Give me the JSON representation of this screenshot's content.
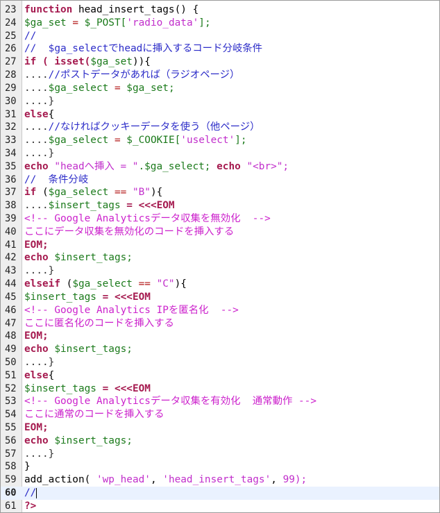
{
  "editor": {
    "current_line": 60,
    "lines": [
      {
        "n": "23",
        "segs": [
          {
            "t": "function",
            "c": "kw"
          },
          {
            "t": " head_insert_tags() {",
            "c": "fn"
          }
        ]
      },
      {
        "n": "24",
        "segs": [
          {
            "t": "$ga_set",
            "c": "var"
          },
          {
            "t": " = ",
            "c": "op"
          },
          {
            "t": "$_POST[",
            "c": "var"
          },
          {
            "t": "'radio_data'",
            "c": "str"
          },
          {
            "t": "];",
            "c": "var"
          }
        ]
      },
      {
        "n": "25",
        "segs": [
          {
            "t": "//",
            "c": "cm"
          }
        ]
      },
      {
        "n": "26",
        "segs": [
          {
            "t": "//  $ga_selectでheadに挿入するコード分岐条件",
            "c": "cm"
          }
        ]
      },
      {
        "n": "27",
        "segs": [
          {
            "t": "if ( isset(",
            "c": "kw"
          },
          {
            "t": "$ga_set",
            "c": "var"
          },
          {
            "t": ")){",
            "c": "fn"
          }
        ]
      },
      {
        "n": "28",
        "segs": [
          {
            "t": "....",
            "c": "ws"
          },
          {
            "t": "//ポストデータがあれば（ラジオページ）",
            "c": "cm"
          }
        ]
      },
      {
        "n": "29",
        "segs": [
          {
            "t": "....",
            "c": "ws"
          },
          {
            "t": "$ga_select",
            "c": "var"
          },
          {
            "t": " = ",
            "c": "op"
          },
          {
            "t": "$ga_set;",
            "c": "var"
          }
        ]
      },
      {
        "n": "30",
        "segs": [
          {
            "t": "....}",
            "c": "ws"
          }
        ]
      },
      {
        "n": "31",
        "segs": [
          {
            "t": "else",
            "c": "kw"
          },
          {
            "t": "{",
            "c": "fn"
          }
        ]
      },
      {
        "n": "32",
        "segs": [
          {
            "t": "....",
            "c": "ws"
          },
          {
            "t": "//なければクッキーデータを使う（他ページ）",
            "c": "cm"
          }
        ]
      },
      {
        "n": "33",
        "segs": [
          {
            "t": "....",
            "c": "ws"
          },
          {
            "t": "$ga_select",
            "c": "var"
          },
          {
            "t": " = ",
            "c": "op"
          },
          {
            "t": "$_COOKIE[",
            "c": "var"
          },
          {
            "t": "'uselect'",
            "c": "str"
          },
          {
            "t": "];",
            "c": "var"
          }
        ]
      },
      {
        "n": "34",
        "segs": [
          {
            "t": "....}",
            "c": "ws"
          }
        ]
      },
      {
        "n": "35",
        "segs": [
          {
            "t": "echo",
            "c": "kw"
          },
          {
            "t": " ",
            "c": "fn"
          },
          {
            "t": "\"headへ挿入 = \"",
            "c": "str"
          },
          {
            "t": ".$ga_select; ",
            "c": "var"
          },
          {
            "t": "echo",
            "c": "kw"
          },
          {
            "t": " ",
            "c": "fn"
          },
          {
            "t": "\"<br>\";",
            "c": "str"
          }
        ]
      },
      {
        "n": "36",
        "segs": [
          {
            "t": "//  条件分岐",
            "c": "cm"
          }
        ]
      },
      {
        "n": "37",
        "segs": [
          {
            "t": "if",
            "c": "kw"
          },
          {
            "t": " (",
            "c": "fn"
          },
          {
            "t": "$ga_select",
            "c": "var"
          },
          {
            "t": " == ",
            "c": "op"
          },
          {
            "t": "\"B\"",
            "c": "str"
          },
          {
            "t": "){",
            "c": "fn"
          }
        ]
      },
      {
        "n": "38",
        "segs": [
          {
            "t": "....",
            "c": "ws"
          },
          {
            "t": "$insert_tags",
            "c": "var"
          },
          {
            "t": " = <<<EOM",
            "c": "kw"
          }
        ]
      },
      {
        "n": "39",
        "segs": [
          {
            "t": "<!-- Google Analyticsデータ収集を無効化  -->",
            "c": "html"
          }
        ]
      },
      {
        "n": "40",
        "segs": [
          {
            "t": "ここにデータ収集を無効化のコードを挿入する",
            "c": "html"
          }
        ]
      },
      {
        "n": "41",
        "segs": [
          {
            "t": "EOM;",
            "c": "kw"
          }
        ]
      },
      {
        "n": "42",
        "segs": [
          {
            "t": "echo",
            "c": "kw"
          },
          {
            "t": " ",
            "c": "fn"
          },
          {
            "t": "$insert_tags;",
            "c": "var"
          }
        ]
      },
      {
        "n": "43",
        "segs": [
          {
            "t": "....}",
            "c": "ws"
          }
        ]
      },
      {
        "n": "44",
        "segs": [
          {
            "t": "elseif",
            "c": "kw"
          },
          {
            "t": " (",
            "c": "fn"
          },
          {
            "t": "$ga_select",
            "c": "var"
          },
          {
            "t": " == ",
            "c": "op"
          },
          {
            "t": "\"C\"",
            "c": "str"
          },
          {
            "t": "){",
            "c": "fn"
          }
        ]
      },
      {
        "n": "45",
        "segs": [
          {
            "t": "$insert_tags",
            "c": "var"
          },
          {
            "t": " = <<<EOM",
            "c": "kw"
          }
        ]
      },
      {
        "n": "46",
        "segs": [
          {
            "t": "<!-- Google Analytics IPを匿名化  -->",
            "c": "html"
          }
        ]
      },
      {
        "n": "47",
        "segs": [
          {
            "t": "ここに匿名化のコードを挿入する",
            "c": "html"
          }
        ]
      },
      {
        "n": "48",
        "segs": [
          {
            "t": "EOM;",
            "c": "kw"
          }
        ]
      },
      {
        "n": "49",
        "segs": [
          {
            "t": "echo",
            "c": "kw"
          },
          {
            "t": " ",
            "c": "fn"
          },
          {
            "t": "$insert_tags;",
            "c": "var"
          }
        ]
      },
      {
        "n": "50",
        "segs": [
          {
            "t": "....}",
            "c": "ws"
          }
        ]
      },
      {
        "n": "51",
        "segs": [
          {
            "t": "else",
            "c": "kw"
          },
          {
            "t": "{",
            "c": "fn"
          }
        ]
      },
      {
        "n": "52",
        "segs": [
          {
            "t": "$insert_tags",
            "c": "var"
          },
          {
            "t": " = <<<EOM",
            "c": "kw"
          }
        ]
      },
      {
        "n": "53",
        "segs": [
          {
            "t": "<!-- Google Analyticsデータ収集を有効化  通常動作 -->",
            "c": "html"
          }
        ]
      },
      {
        "n": "54",
        "segs": [
          {
            "t": "ここに通常のコードを挿入する",
            "c": "html"
          }
        ]
      },
      {
        "n": "55",
        "segs": [
          {
            "t": "EOM;",
            "c": "kw"
          }
        ]
      },
      {
        "n": "56",
        "segs": [
          {
            "t": "echo",
            "c": "kw"
          },
          {
            "t": " ",
            "c": "fn"
          },
          {
            "t": "$insert_tags;",
            "c": "var"
          }
        ]
      },
      {
        "n": "57",
        "segs": [
          {
            "t": "....}",
            "c": "ws"
          }
        ]
      },
      {
        "n": "58",
        "segs": [
          {
            "t": "}",
            "c": "fn"
          }
        ]
      },
      {
        "n": "59",
        "segs": [
          {
            "t": "add_action( ",
            "c": "fn"
          },
          {
            "t": "'wp_head'",
            "c": "str"
          },
          {
            "t": ", ",
            "c": "fn"
          },
          {
            "t": "'head_insert_tags'",
            "c": "str"
          },
          {
            "t": ", ",
            "c": "fn"
          },
          {
            "t": "99);",
            "c": "str"
          }
        ]
      },
      {
        "n": "60",
        "segs": [
          {
            "t": "//",
            "c": "cm"
          }
        ]
      },
      {
        "n": "61",
        "segs": [
          {
            "t": "?>",
            "c": "kw"
          }
        ]
      }
    ]
  }
}
